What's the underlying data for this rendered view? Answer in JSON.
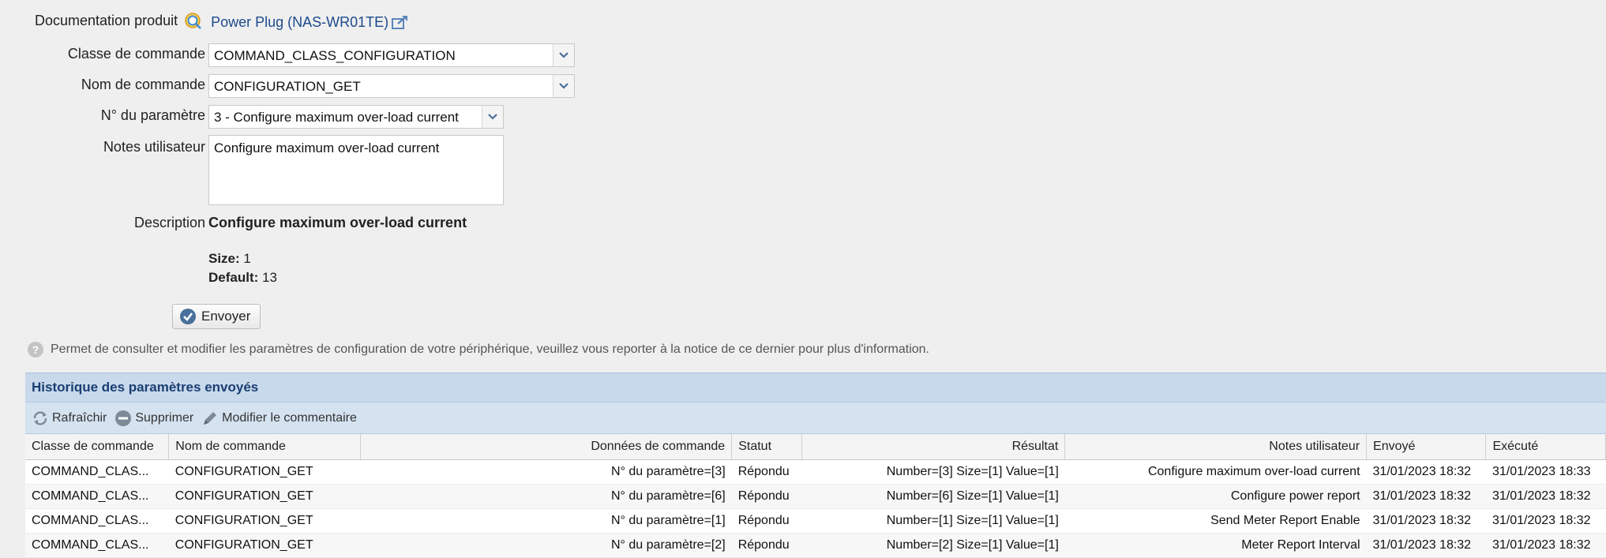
{
  "doc": {
    "label": "Documentation produit",
    "product_link": "Power Plug (NAS-WR01TE)"
  },
  "form": {
    "class_label": "Classe de commande",
    "class_value": "COMMAND_CLASS_CONFIGURATION",
    "name_label": "Nom de commande",
    "name_value": "CONFIGURATION_GET",
    "param_label": "N° du paramètre",
    "param_value": "3 - Configure maximum over-load current",
    "notes_label": "Notes utilisateur",
    "notes_value": "Configure maximum over-load current",
    "desc_label": "Description",
    "desc_title": "Configure maximum over-load current",
    "size_label": "Size:",
    "size_value": "1",
    "default_label": "Default:",
    "default_value": "13",
    "send_label": "Envoyer"
  },
  "info_text": "Permet de consulter et modifier les paramètres de configuration de votre périphérique, veuillez vous reporter à la notice de ce dernier pour plus d'information.",
  "history": {
    "title": "Historique des paramètres envoyés",
    "toolbar": {
      "refresh": "Rafraîchir",
      "delete": "Supprimer",
      "edit_comment": "Modifier le commentaire"
    },
    "columns": [
      "Classe de commande",
      "Nom de commande",
      "Données de commande",
      "Statut",
      "Résultat",
      "Notes utilisateur",
      "Envoyé",
      "Exécuté"
    ],
    "rows": [
      [
        "COMMAND_CLAS...",
        "CONFIGURATION_GET",
        "N° du paramètre=[3]",
        "Répondu",
        "Number=[3] Size=[1] Value=[1]",
        "Configure maximum over-load current",
        "31/01/2023 18:32",
        "31/01/2023 18:33"
      ],
      [
        "COMMAND_CLAS...",
        "CONFIGURATION_GET",
        "N° du paramètre=[6]",
        "Répondu",
        "Number=[6] Size=[1] Value=[1]",
        "Configure power report",
        "31/01/2023 18:32",
        "31/01/2023 18:32"
      ],
      [
        "COMMAND_CLAS...",
        "CONFIGURATION_GET",
        "N° du paramètre=[1]",
        "Répondu",
        "Number=[1] Size=[1] Value=[1]",
        "Send Meter Report Enable",
        "31/01/2023 18:32",
        "31/01/2023 18:32"
      ],
      [
        "COMMAND_CLAS...",
        "CONFIGURATION_GET",
        "N° du paramètre=[2]",
        "Répondu",
        "Number=[2] Size=[1] Value=[1]",
        "Meter Report Interval",
        "31/01/2023 18:32",
        "31/01/2023 18:32"
      ]
    ]
  },
  "colors": {
    "link": "#1c4a8c",
    "panel_header": "#c8d9ec",
    "toolbar": "#d5e2f0",
    "accent_icon": "#4a6f9c"
  }
}
